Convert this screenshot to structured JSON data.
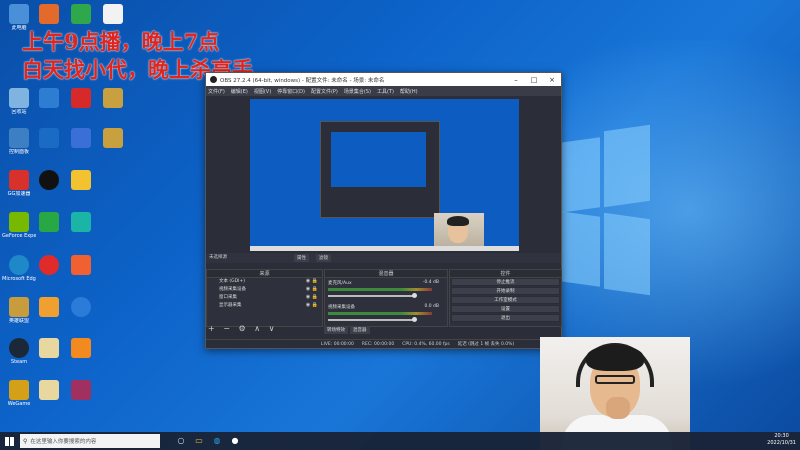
{
  "overlay": {
    "line1": "上午9点播，晚上7点",
    "line2": "白天找小代，晚上杀高手"
  },
  "desktop_icons": [
    {
      "label": "此电脑",
      "color": "#4a90d9"
    },
    {
      "label": "回收站",
      "color": "#7fb3e0"
    },
    {
      "label": "控制面板",
      "color": "#3c7fc2"
    },
    {
      "label": "网络",
      "color": "#5a9ad6"
    },
    {
      "label": "GG加速器",
      "color": "#d8302a"
    },
    {
      "label": "GeForce Experience",
      "color": "#76b900"
    },
    {
      "label": "Microsoft Edge",
      "color": "#1e88c9"
    },
    {
      "label": "英雄联盟",
      "color": "#c89b3c"
    },
    {
      "label": "Steam",
      "color": "#1b2838"
    },
    {
      "label": "WeGame",
      "color": "#d4a017"
    }
  ],
  "obs": {
    "title": "OBS 27.2.4 (64-bit, windows) - 配置文件: 未命名 - 场景: 未命名",
    "menu": [
      "文件(F)",
      "编辑(E)",
      "视图(V)",
      "停靠窗口(D)",
      "配置文件(P)",
      "场景集合(S)",
      "工具(T)",
      "帮助(H)"
    ],
    "no_source": "未选择源",
    "prop_btn": "属性",
    "filter_btn": "滤镜",
    "sources_header": "来源",
    "sources": [
      "文本 (GDI+)",
      "视频采集设备",
      "窗口采集",
      "显示器采集"
    ],
    "mixer_header": "混音器",
    "mixer": [
      {
        "name": "麦克风/Aux",
        "db": "-0.4 dB"
      },
      {
        "name": "视频采集设备",
        "db": "0.0 dB"
      }
    ],
    "controls_header": "控件",
    "controls": [
      "停止推流",
      "开始录制",
      "工作室模式",
      "设置",
      "退出"
    ],
    "tabs": [
      "转场特效",
      "混音器"
    ],
    "status": [
      "LIVE: 00:00:00",
      "REC: 00:00:00",
      "CPU: 0.4%, 60.00 fps",
      "延迟 (跳过 1 帧 丢失 0.0%)"
    ]
  },
  "taskbar": {
    "search_placeholder": "在这里输入你要搜索的内容",
    "time": "20:30",
    "date": "2022/10/31"
  }
}
